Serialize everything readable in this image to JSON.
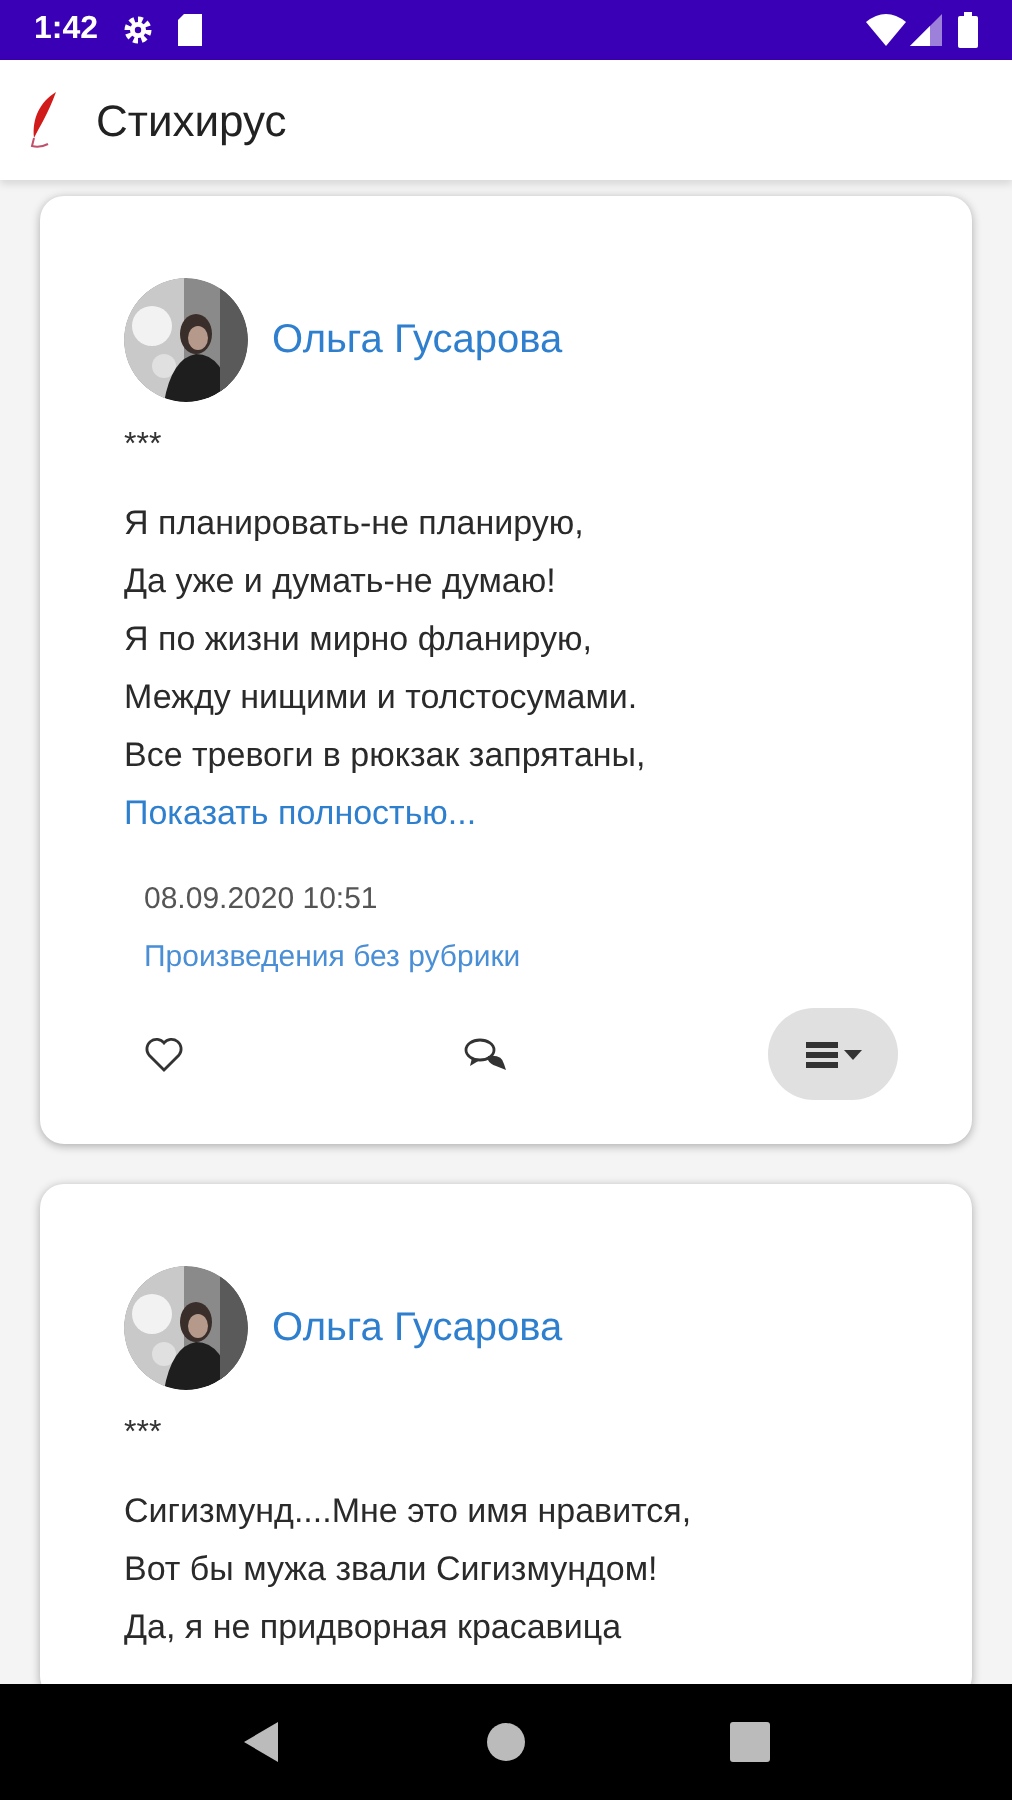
{
  "status_bar": {
    "time": "1:42"
  },
  "app_bar": {
    "title": "Стихирус"
  },
  "posts": [
    {
      "author": "Ольга Гусарова",
      "heading": "***",
      "lines": [
        "Я планировать-не планирую,",
        "Да уже и думать-не думаю!",
        "Я по жизни мирно фланирую,",
        "Между нищими и толстосумами.",
        "Все тревоги в рюкзак запрятаны,"
      ],
      "more_link": "Показать полностью...",
      "date": "08.09.2020 10:51",
      "category": "Произведения без рубрики",
      "liked": false
    },
    {
      "author": "Ольга Гусарова",
      "heading": "***",
      "lines": [
        "Сигизмунд....Мне это имя нравится,",
        "Вот бы мужа звали Сигизмундом!",
        "Да, я не придворная красавица"
      ]
    }
  ]
}
